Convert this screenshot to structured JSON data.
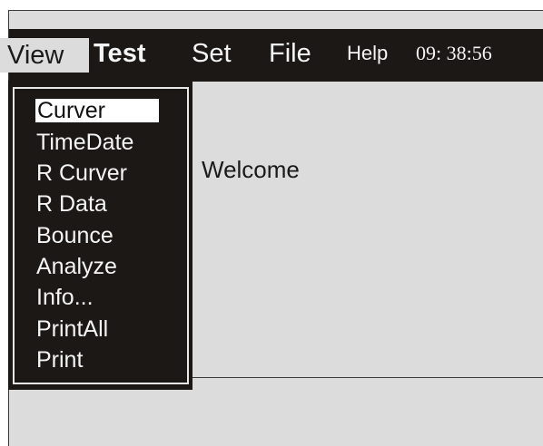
{
  "menubar": {
    "items": [
      {
        "label": "View"
      },
      {
        "label": "Test"
      },
      {
        "label": "Set"
      },
      {
        "label": "File"
      },
      {
        "label": "Help"
      }
    ],
    "clock": "09: 38:56"
  },
  "dropdown": {
    "items": [
      {
        "label": "Curver",
        "selected": true
      },
      {
        "label": "TimeDate"
      },
      {
        "label": "R Curver"
      },
      {
        "label": "R Data"
      },
      {
        "label": "Bounce"
      },
      {
        "label": "Analyze"
      },
      {
        "label": "Info..."
      },
      {
        "label": "PrintAll"
      },
      {
        "label": "Print"
      }
    ]
  },
  "main": {
    "welcome_text": "Welcome"
  },
  "colors": {
    "background": "#dcdcdc",
    "menubar": "#1b1816",
    "highlight": "#ffffff"
  }
}
